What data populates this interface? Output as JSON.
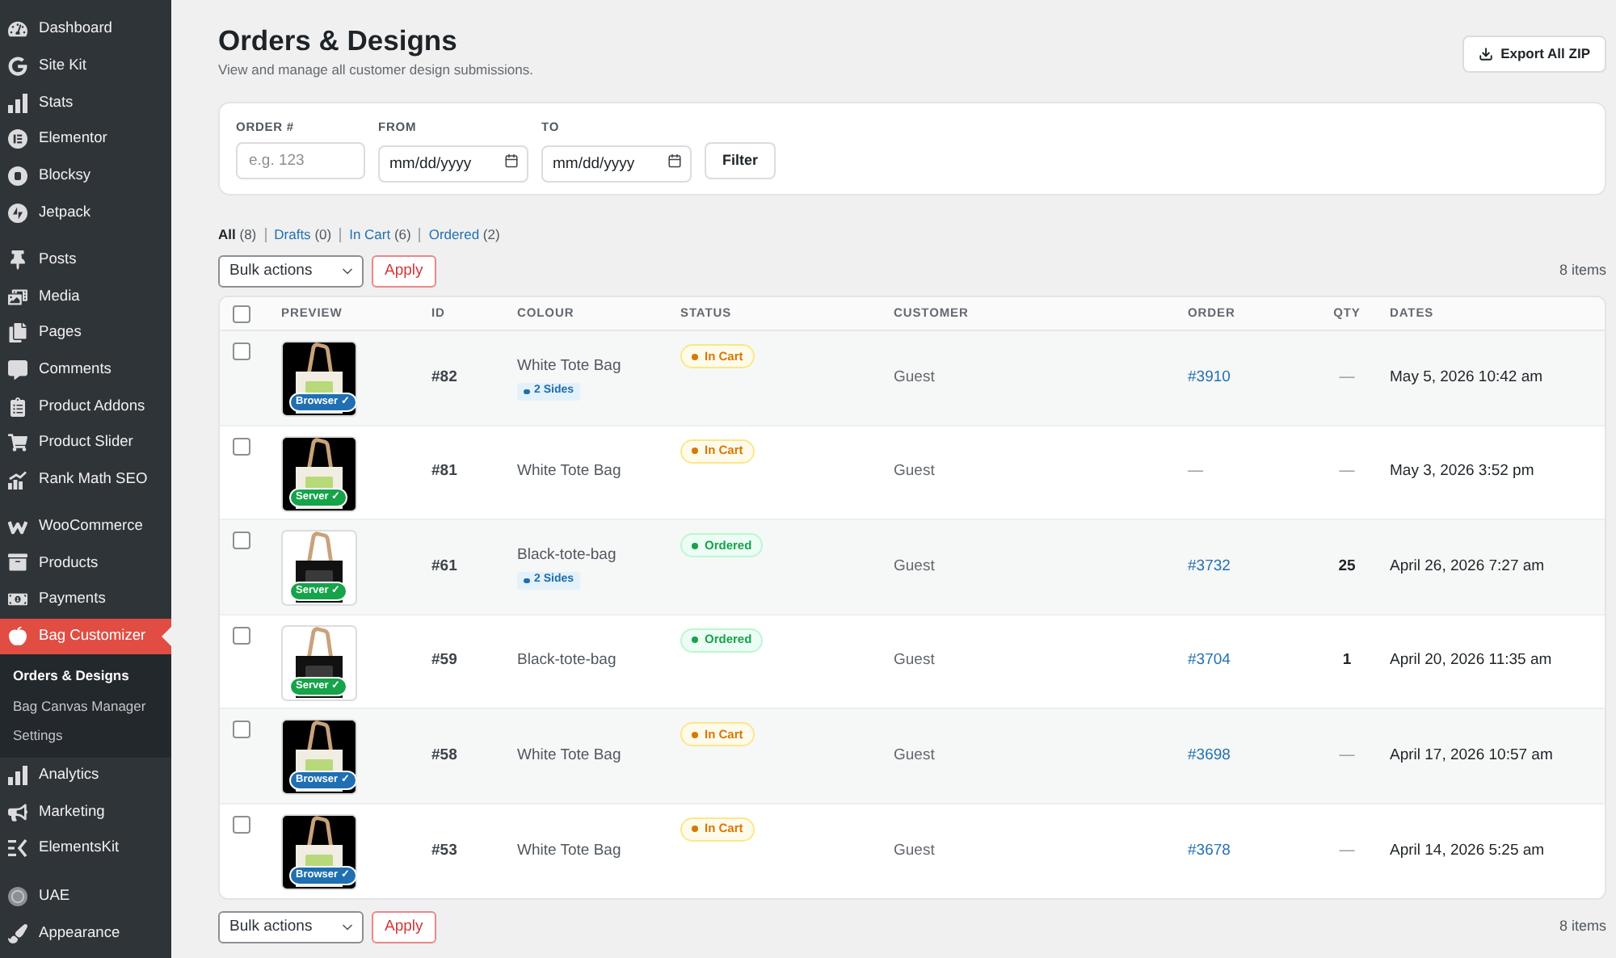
{
  "sidebar": {
    "sections": [
      {
        "items": [
          {
            "label": "Dashboard",
            "selected": false
          },
          {
            "label": "Site Kit",
            "selected": false
          },
          {
            "label": "Stats",
            "selected": false
          },
          {
            "label": "Elementor",
            "selected": false
          },
          {
            "label": "Blocksy",
            "selected": false
          },
          {
            "label": "Jetpack",
            "selected": false
          }
        ]
      },
      {
        "items": [
          {
            "label": "Posts",
            "selected": false
          },
          {
            "label": "Media",
            "selected": false
          },
          {
            "label": "Pages",
            "selected": false
          },
          {
            "label": "Comments",
            "selected": false
          },
          {
            "label": "Product Addons",
            "selected": false
          },
          {
            "label": "Product Slider",
            "selected": false
          },
          {
            "label": "Rank Math SEO",
            "selected": false
          }
        ]
      },
      {
        "items": [
          {
            "label": "WooCommerce",
            "selected": false
          },
          {
            "label": "Products",
            "selected": false
          },
          {
            "label": "Payments",
            "selected": false
          },
          {
            "label": "Bag Customizer",
            "selected": true,
            "children": [
              {
                "label": "Orders & Designs",
                "selected": true
              },
              {
                "label": "Bag Canvas Manager",
                "selected": false
              },
              {
                "label": "Settings",
                "selected": false
              }
            ]
          },
          {
            "label": "Analytics",
            "selected": false
          },
          {
            "label": "Marketing",
            "selected": false
          },
          {
            "label": "ElementsKit",
            "selected": false
          }
        ]
      },
      {
        "items": [
          {
            "label": "UAE",
            "selected": false
          },
          {
            "label": "Appearance",
            "selected": false
          }
        ]
      }
    ]
  },
  "page": {
    "title": "Orders & Designs",
    "subtitle": "View and manage all customer design submissions.",
    "export_button": "Export All ZIP"
  },
  "filters": {
    "fields": [
      {
        "kind": "text",
        "label": "ORDER #",
        "placeholder": "e.g. 123"
      },
      {
        "kind": "date",
        "label": "FROM",
        "placeholder": "mm/dd/yyyy"
      },
      {
        "kind": "date",
        "label": "TO",
        "placeholder": "mm/dd/yyyy"
      }
    ],
    "button": "Filter"
  },
  "status_views": [
    {
      "label": "All",
      "count": "(8)",
      "selected": true
    },
    {
      "label": "Drafts",
      "count": "(0)",
      "selected": false
    },
    {
      "label": "In Cart",
      "count": "(6)",
      "selected": false
    },
    {
      "label": "Ordered",
      "count": "(2)",
      "selected": false
    }
  ],
  "bulk_top": {
    "select": "Bulk actions",
    "button": "Apply",
    "count": "8 items"
  },
  "table": {
    "select_all_checked": false,
    "columns": [
      "PREVIEW",
      "ID",
      "COLOUR",
      "STATUS",
      "CUSTOMER",
      "ORDER",
      "QTY",
      "DATES"
    ],
    "rows": [
      {
        "checked": false,
        "preview": {
          "kind": "white-bag",
          "badge": {
            "kind": "browser",
            "label": "Browser ✓"
          }
        },
        "id": "#82",
        "colour": "White Tote Bag",
        "sides": "2 Sides",
        "status": {
          "kind": "in_cart",
          "label": "In Cart"
        },
        "customer": "Guest",
        "order": "#3910",
        "order_link": true,
        "qty": "—",
        "qty_muted": true,
        "date": "May 5, 2026 10:42 am"
      },
      {
        "checked": false,
        "preview": {
          "kind": "white-bag",
          "badge": {
            "kind": "server",
            "label": "Server ✓"
          }
        },
        "id": "#81",
        "colour": "White Tote Bag",
        "status": {
          "kind": "in_cart",
          "label": "In Cart"
        },
        "customer": "Guest",
        "order": "—",
        "order_link": false,
        "qty": "—",
        "qty_muted": true,
        "date": "May 3, 2026 3:52 pm"
      },
      {
        "checked": false,
        "preview": {
          "kind": "black-bag",
          "badge": {
            "kind": "server",
            "label": "Server ✓"
          }
        },
        "id": "#61",
        "colour": "Black-tote-bag",
        "sides": "2 Sides",
        "status": {
          "kind": "ordered",
          "label": "Ordered"
        },
        "customer": "Guest",
        "order": "#3732",
        "order_link": true,
        "qty": "25",
        "qty_muted": false,
        "date": "April 26, 2026 7:27 am"
      },
      {
        "checked": false,
        "preview": {
          "kind": "black-bag",
          "badge": {
            "kind": "server",
            "label": "Server ✓"
          }
        },
        "id": "#59",
        "colour": "Black-tote-bag",
        "status": {
          "kind": "ordered",
          "label": "Ordered"
        },
        "customer": "Guest",
        "order": "#3704",
        "order_link": true,
        "qty": "1",
        "qty_muted": false,
        "date": "April 20, 2026 11:35 am"
      },
      {
        "checked": false,
        "preview": {
          "kind": "white-bag",
          "badge": {
            "kind": "browser",
            "label": "Browser ✓"
          }
        },
        "id": "#58",
        "colour": "White Tote Bag",
        "status": {
          "kind": "in_cart",
          "label": "In Cart"
        },
        "customer": "Guest",
        "order": "#3698",
        "order_link": true,
        "qty": "—",
        "qty_muted": true,
        "date": "April 17, 2026 10:57 am"
      },
      {
        "checked": false,
        "preview": {
          "kind": "white-bag",
          "badge": {
            "kind": "browser",
            "label": "Browser ✓"
          }
        },
        "id": "#53",
        "colour": "White Tote Bag",
        "status": {
          "kind": "in_cart",
          "label": "In Cart"
        },
        "customer": "Guest",
        "order": "#3678",
        "order_link": true,
        "qty": "—",
        "qty_muted": true,
        "date": "April 14, 2026 5:25 am"
      }
    ]
  },
  "bulk_bottom": {
    "select": "Bulk actions",
    "button": "Apply",
    "count": "8 items"
  }
}
